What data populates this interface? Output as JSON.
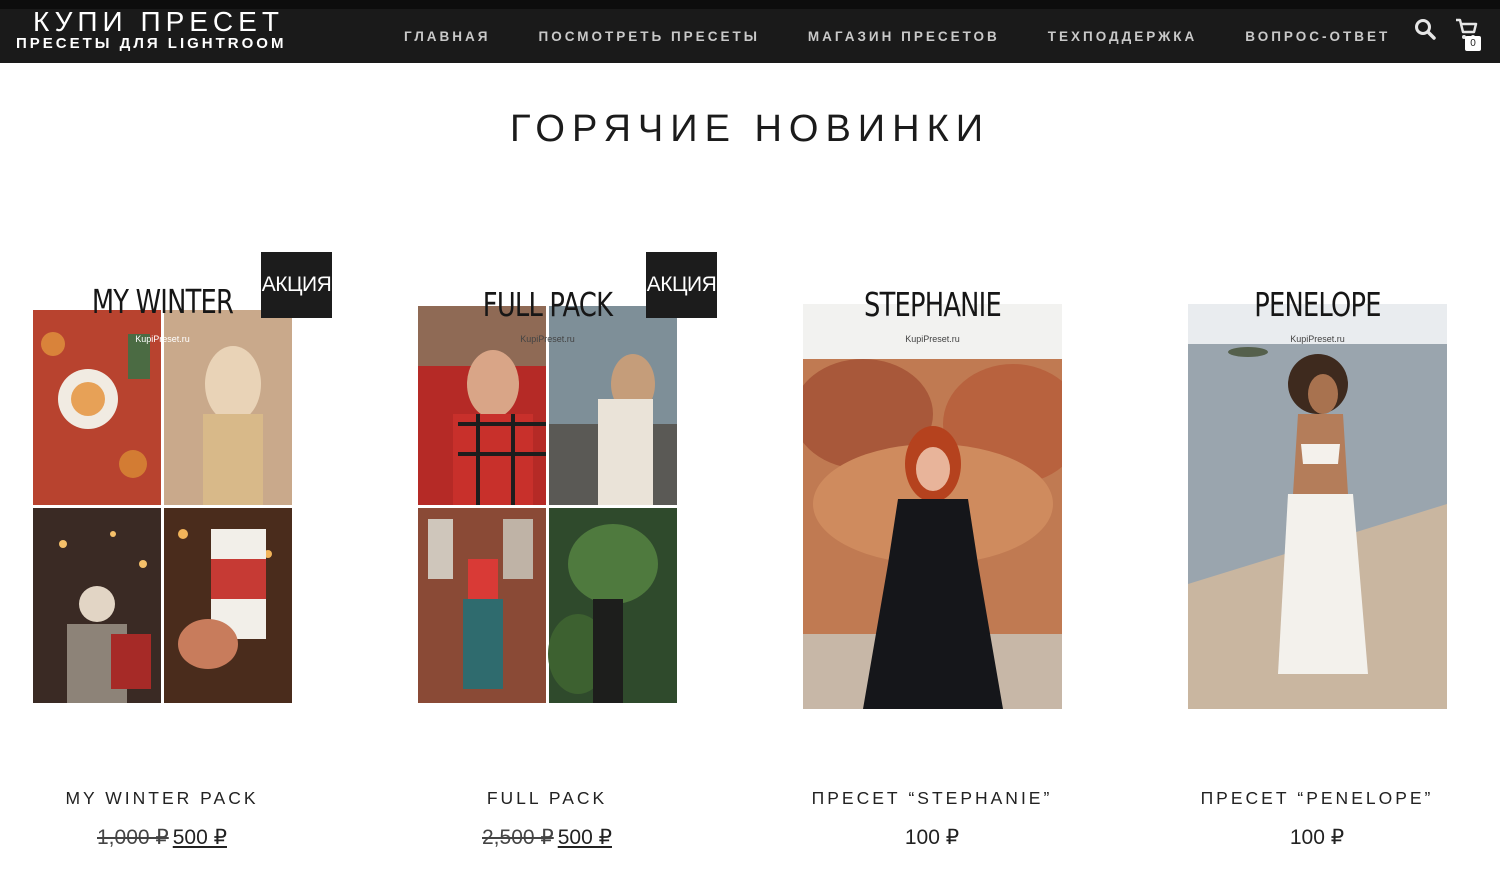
{
  "brand": {
    "title": "КУПИ ПРЕСЕТ",
    "subtitle": "ПРЕСЕТЫ ДЛЯ LIGHTROOM"
  },
  "nav": [
    {
      "label": "ГЛАВНАЯ"
    },
    {
      "label": "ПОСМОТРЕТЬ ПРЕСЕТЫ"
    },
    {
      "label": "МАГАЗИН ПРЕСЕТОВ"
    },
    {
      "label": "ТЕХПОДДЕРЖКА"
    },
    {
      "label": "ВОПРОС-ОТВЕТ"
    }
  ],
  "cart": {
    "count": "0",
    "icon": "cart-icon"
  },
  "search": {
    "icon": "search-icon"
  },
  "section_title": "ГОРЯЧИЕ НОВИНКИ",
  "products": [
    {
      "image_title": "MY WINTER",
      "image_site": "KupiPreset.ru",
      "badge": "АКЦИЯ",
      "name": "MY WINTER PACK",
      "old_price": "1,000 ₽",
      "price": "500 ₽"
    },
    {
      "image_title": "FULL PACK",
      "image_site": "KupiPreset.ru",
      "badge": "АКЦИЯ",
      "name": "FULL PACK",
      "old_price": "2,500 ₽",
      "price": "500 ₽"
    },
    {
      "image_title": "STEPHANIE",
      "image_site": "KupiPreset.ru",
      "badge": "",
      "name": "ПРЕСЕТ “STEPHANIE”",
      "old_price": "",
      "price": "100 ₽"
    },
    {
      "image_title": "PENELOPE",
      "image_site": "KupiPreset.ru",
      "badge": "",
      "name": "ПРЕСЕТ “PENELOPE”",
      "old_price": "",
      "price": "100 ₽"
    }
  ],
  "colors": {
    "header_bg": "#1a1a1a",
    "badge_bg": "#1c1c1c",
    "nav_text": "#c9c9c9"
  }
}
